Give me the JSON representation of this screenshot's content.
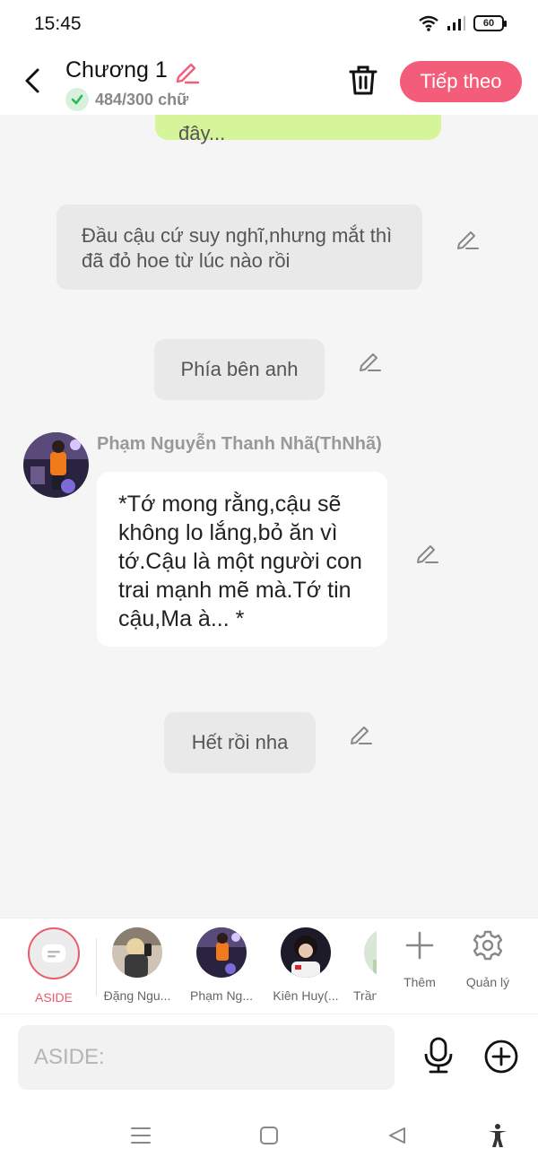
{
  "status": {
    "time": "15:45",
    "battery": "60"
  },
  "header": {
    "title": "Chương 1",
    "word_count": "484/300 chữ",
    "next_label": "Tiếp theo"
  },
  "colors": {
    "accent": "#f35d79",
    "aside_accent": "#e95c6b",
    "green_bubble": "#d6f59a",
    "check_green": "#2cb84f"
  },
  "messages": {
    "partial_green": "đây...",
    "aside_1": "Đầu cậu cứ suy nghĩ,nhưng mắt thì đã đỏ hoe từ lúc nào rồi",
    "aside_2": "Phía bên anh",
    "sender": "Phạm Nguyễn Thanh Nhã(ThNhã)",
    "message_1": "*Tớ mong rằng,cậu sẽ không lo lắng,bỏ ăn vì tớ.Cậu là một người con trai mạnh mẽ mà.Tớ tin cậu,Ma à... *",
    "aside_3": "Hết rồi nha"
  },
  "characters": [
    {
      "label": "ASIDE",
      "icon": "aside-chat-icon"
    },
    {
      "label": "Đặng Ngu...",
      "icon": "avatar"
    },
    {
      "label": "Phạm Ng...",
      "icon": "avatar"
    },
    {
      "label": "Kiên Huy(...",
      "icon": "avatar"
    },
    {
      "label": "Trần",
      "icon": "avatar"
    }
  ],
  "tools": {
    "add_label": "Thêm",
    "manage_label": "Quản lý"
  },
  "input": {
    "placeholder": "ASIDE:"
  },
  "icons": [
    "back-icon",
    "edit-icon",
    "check-icon",
    "trash-icon",
    "pencil-icon",
    "mic-icon",
    "plus-circle-icon",
    "gear-icon",
    "menu-icon",
    "home-square-icon",
    "back-triangle-icon",
    "accessibility-icon"
  ]
}
